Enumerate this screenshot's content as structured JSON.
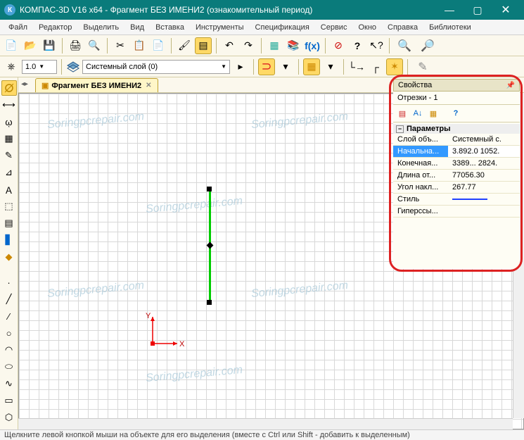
{
  "title": "КОМПАС-3D V16  x64 - Фрагмент БЕЗ ИМЕНИ2 (ознакомительный период)",
  "app_icon_letter": "К",
  "menu": [
    "Файл",
    "Редактор",
    "Выделить",
    "Вид",
    "Вставка",
    "Инструменты",
    "Спецификация",
    "Сервис",
    "Окно",
    "Справка",
    "Библиотеки"
  ],
  "toolbar1": {
    "scale_value": "1.0",
    "layer_label": "Системный слой (0)"
  },
  "icons": {
    "new": "new-doc-icon",
    "open": "open-icon",
    "save": "save-icon",
    "print": "print-icon",
    "preview": "preview-icon",
    "cut": "cut-icon",
    "copy": "copy-icon",
    "paste": "paste-icon",
    "brush": "brush-icon",
    "props": "properties-icon",
    "undo": "undo-icon",
    "redo": "redo-icon",
    "vars": "variables-icon",
    "libs": "libraries-icon",
    "fx": "fx-icon",
    "stop": "stop-icon",
    "help": "help-icon",
    "arrow": "arrow-help-icon",
    "zoomin": "zoom-in-icon",
    "zoomout": "zoom-out-icon",
    "anchor": "anchor-icon",
    "magnet": "magnet-icon",
    "snap": "snap-icon",
    "grid": "grid-icon",
    "ortho": "ortho-icon",
    "round": "round-icon",
    "param": "parametric-icon",
    "pencil": "pencil-icon"
  },
  "fx_label": "f(x)",
  "doc_tab": {
    "label": "Фрагмент БЕЗ ИМЕНИ2",
    "icon": "fragment-icon"
  },
  "properties": {
    "panel_title": "Свойства",
    "subtitle": "Отрезки - 1",
    "group": "Параметры",
    "rows": [
      {
        "key": "Слой объ...",
        "val": "Системный с.",
        "sel": false
      },
      {
        "key": "Начальна...",
        "val": "3.892.0 1052.",
        "sel": true
      },
      {
        "key": "Конечная...",
        "val": "3389... 2824.",
        "sel": false
      },
      {
        "key": "Длина от...",
        "val": "77056.30",
        "sel": false
      },
      {
        "key": "Угол накл...",
        "val": "267.77",
        "sel": false
      },
      {
        "key": "Стиль",
        "val": "__STYLE__",
        "sel": false
      },
      {
        "key": "Гиперссы...",
        "val": "",
        "sel": false
      }
    ]
  },
  "statusbar": "Щелкните левой кнопкой мыши на объекте для его выделения (вместе с Ctrl или Shift - добавить к выделенным)",
  "axis_labels": {
    "x": "X",
    "y": "Y"
  },
  "watermark": "Soringpcrepair.com"
}
